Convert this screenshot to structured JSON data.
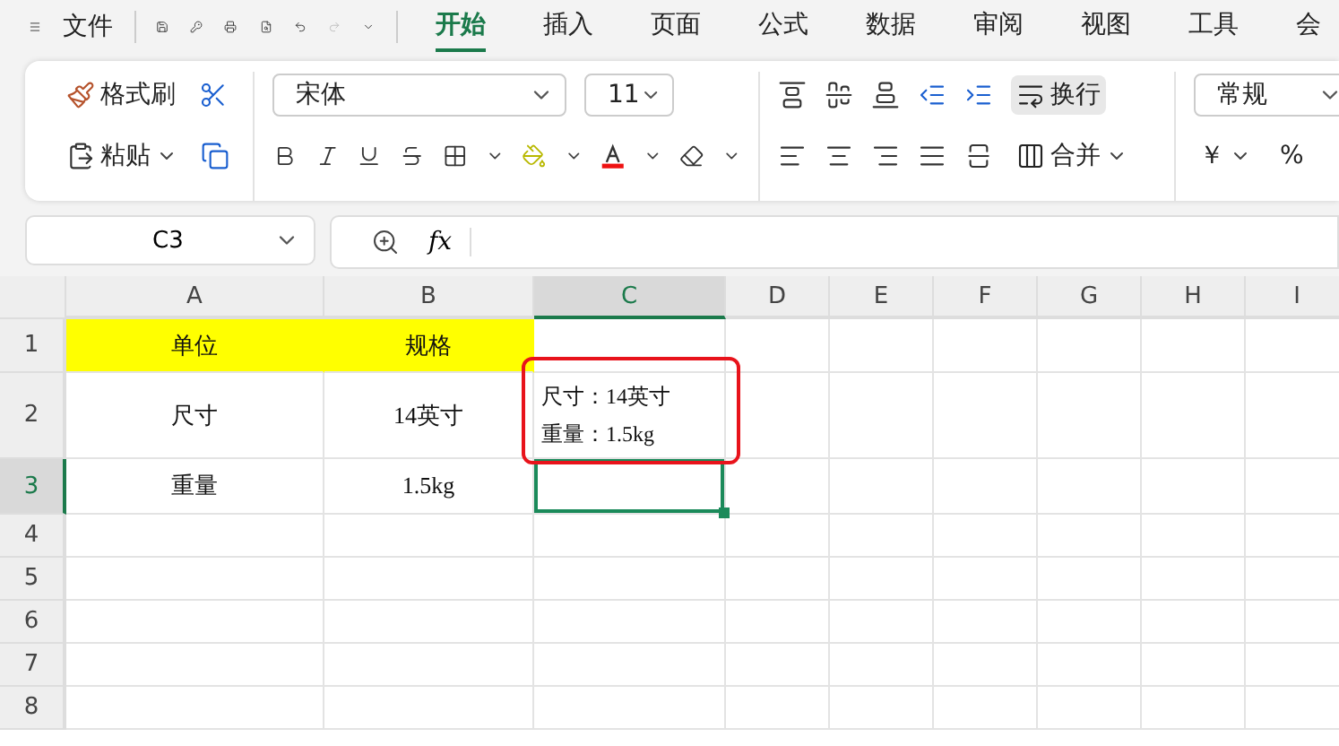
{
  "menu": {
    "file": "文件"
  },
  "tabs": [
    {
      "label": "开始",
      "selected": true
    },
    {
      "label": "插入",
      "selected": false
    },
    {
      "label": "页面",
      "selected": false
    },
    {
      "label": "公式",
      "selected": false
    },
    {
      "label": "数据",
      "selected": false
    },
    {
      "label": "审阅",
      "selected": false
    },
    {
      "label": "视图",
      "selected": false
    },
    {
      "label": "工具",
      "selected": false
    },
    {
      "label": "会",
      "selected": false
    }
  ],
  "ribbon": {
    "format_painter": "格式刷",
    "paste": "粘贴",
    "font": "宋体",
    "font_size": "11",
    "wrap": "换行",
    "wrap_on": true,
    "merge": "合并",
    "number_format": "常规",
    "currency": "￥",
    "percent": "%"
  },
  "formula_bar": {
    "name_box": "C3",
    "fx": "fx"
  },
  "grid": {
    "columns": [
      {
        "label": "A",
        "selected": false
      },
      {
        "label": "B",
        "selected": false
      },
      {
        "label": "C",
        "selected": true
      },
      {
        "label": "D",
        "selected": false
      },
      {
        "label": "E",
        "selected": false
      },
      {
        "label": "F",
        "selected": false
      },
      {
        "label": "G",
        "selected": false
      },
      {
        "label": "H",
        "selected": false
      },
      {
        "label": "I",
        "selected": false
      }
    ],
    "rows": [
      {
        "label": "1",
        "selected": false,
        "cells": [
          {
            "text": "单位",
            "highlighted": true
          },
          {
            "text": "规格",
            "highlighted": true
          }
        ]
      },
      {
        "label": "2",
        "selected": false,
        "cells": [
          {
            "text": "尺寸",
            "highlighted": false
          },
          {
            "text": "14英寸",
            "highlighted": false
          },
          {
            "lines": [
              "尺寸：14英寸",
              "重量：1.5kg"
            ],
            "boxed": true
          }
        ]
      },
      {
        "label": "3",
        "selected": true,
        "cells": [
          {
            "text": "重量",
            "highlighted": false
          },
          {
            "text": "1.5kg",
            "highlighted": false
          },
          {
            "active": true
          }
        ]
      },
      {
        "label": "4",
        "selected": false,
        "cells": []
      },
      {
        "label": "5",
        "selected": false,
        "cells": []
      },
      {
        "label": "6",
        "selected": false,
        "cells": []
      },
      {
        "label": "7",
        "selected": false,
        "cells": []
      },
      {
        "label": "8",
        "selected": false,
        "cells": []
      }
    ]
  }
}
